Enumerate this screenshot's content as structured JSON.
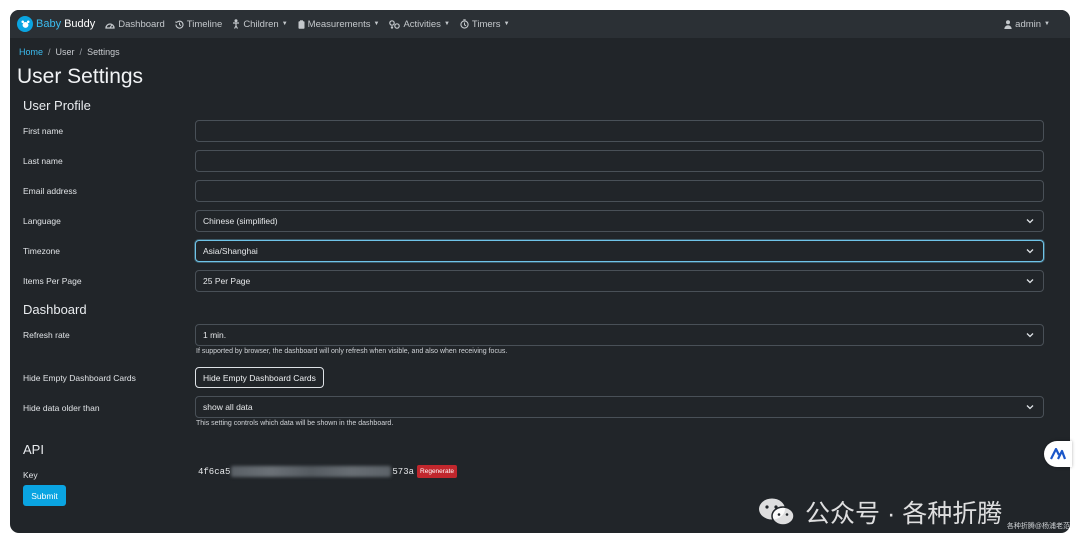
{
  "navbar": {
    "brand_part1": "Baby",
    "brand_part2": "Buddy",
    "items": [
      {
        "label": "Dashboard",
        "icon": "dashboard-icon"
      },
      {
        "label": "Timeline",
        "icon": "history-icon"
      },
      {
        "label": "Children",
        "icon": "child-icon",
        "dropdown": true
      },
      {
        "label": "Measurements",
        "icon": "clipboard-icon",
        "dropdown": true
      },
      {
        "label": "Activities",
        "icon": "activities-icon",
        "dropdown": true
      },
      {
        "label": "Timers",
        "icon": "timer-icon",
        "dropdown": true
      }
    ],
    "user": "admin"
  },
  "breadcrumb": [
    "Home",
    "User",
    "Settings"
  ],
  "page_title": "User Settings",
  "profile": {
    "title": "User Profile",
    "first_name": {
      "label": "First name",
      "value": ""
    },
    "last_name": {
      "label": "Last name",
      "value": ""
    },
    "email": {
      "label": "Email address",
      "value": ""
    },
    "language": {
      "label": "Language",
      "value": "Chinese (simplified)"
    },
    "timezone": {
      "label": "Timezone",
      "value": "Asia/Shanghai"
    },
    "items_per_page": {
      "label": "Items Per Page",
      "value": "25 Per Page"
    }
  },
  "dashboard": {
    "title": "Dashboard",
    "refresh_rate": {
      "label": "Refresh rate",
      "value": "1 min.",
      "help": "If supported by browser, the dashboard will only refresh when visible, and also when receiving focus."
    },
    "hide_empty": {
      "label": "Hide Empty Dashboard Cards",
      "button": "Hide Empty Dashboard Cards"
    },
    "hide_older": {
      "label": "Hide data older than",
      "value": "show all data",
      "help": "This setting controls which data will be shown in the dashboard."
    }
  },
  "api": {
    "title": "API",
    "key_label": "Key",
    "key_prefix": "4f6ca5",
    "key_suffix": "573a",
    "regenerate": "Regenerate"
  },
  "submit": "Submit",
  "watermark": {
    "text": "公众号 · 各种折腾",
    "small": "各种折腾@杨浦老范"
  },
  "colors": {
    "background": "#212529",
    "navbar": "#2b3035",
    "accent": "#0aa4e1",
    "danger": "#c1272d"
  }
}
